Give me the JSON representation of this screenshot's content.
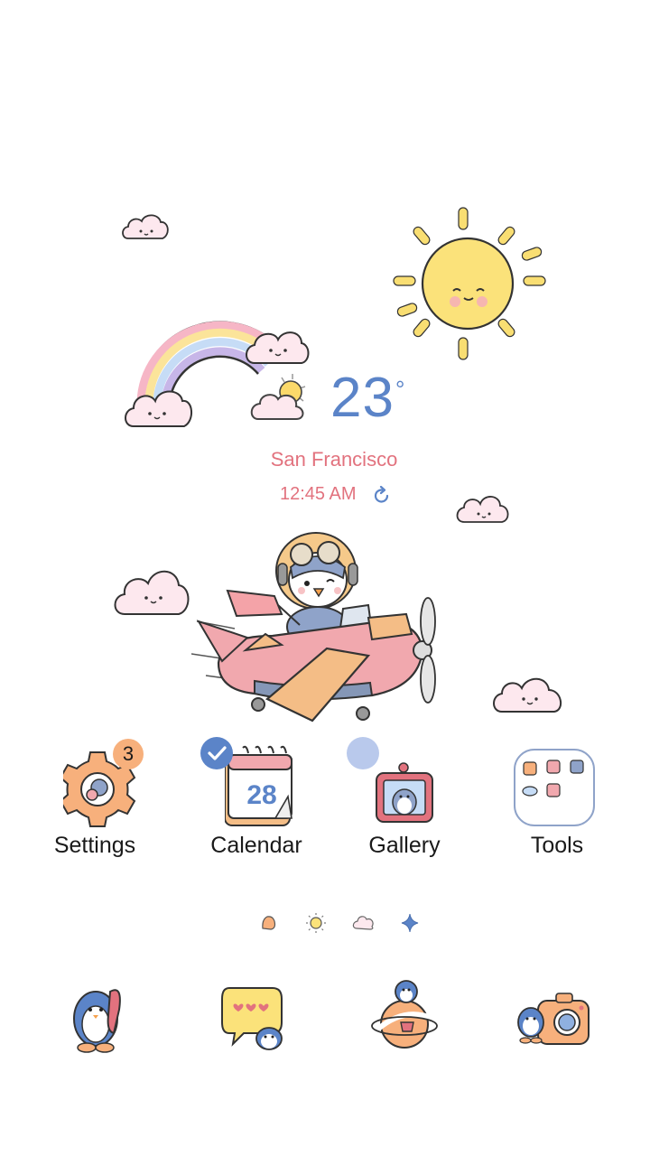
{
  "weather": {
    "temperature": "23",
    "degree_symbol": "°",
    "city": "San Francisco",
    "time": "12:45 AM",
    "condition_icon": "partly-sunny-cloud-icon",
    "refresh_icon": "refresh-icon"
  },
  "apps": [
    {
      "label": "Settings",
      "icon": "gear-penguin-icon",
      "badge": "3"
    },
    {
      "label": "Calendar",
      "icon": "calendar-icon",
      "calendar_day": "28",
      "status": "check-badge-icon"
    },
    {
      "label": "Gallery",
      "icon": "photo-frame-penguin-icon",
      "status": "blue-dot-badge"
    },
    {
      "label": "Tools",
      "icon": "tools-folder-icon"
    }
  ],
  "pager": {
    "pages": 4,
    "current": 1,
    "icons": [
      "paw-icon",
      "sun-icon",
      "cloud-icon",
      "sparkle-icon"
    ]
  },
  "dock": [
    {
      "icon": "phone-penguin-icon"
    },
    {
      "icon": "message-hearts-icon"
    },
    {
      "icon": "planet-penguin-icon"
    },
    {
      "icon": "camera-penguin-icon"
    }
  ],
  "decor": {
    "illustrations": [
      "rainbow-icon",
      "sun-face-icon",
      "cloud-face-icon",
      "penguin-pilot-airplane-icon"
    ]
  },
  "colors": {
    "accent_blue": "#5b84c8",
    "accent_pink": "#e2727e",
    "badge_orange": "#f7b07c",
    "dot_blue": "#b9c9ec"
  }
}
